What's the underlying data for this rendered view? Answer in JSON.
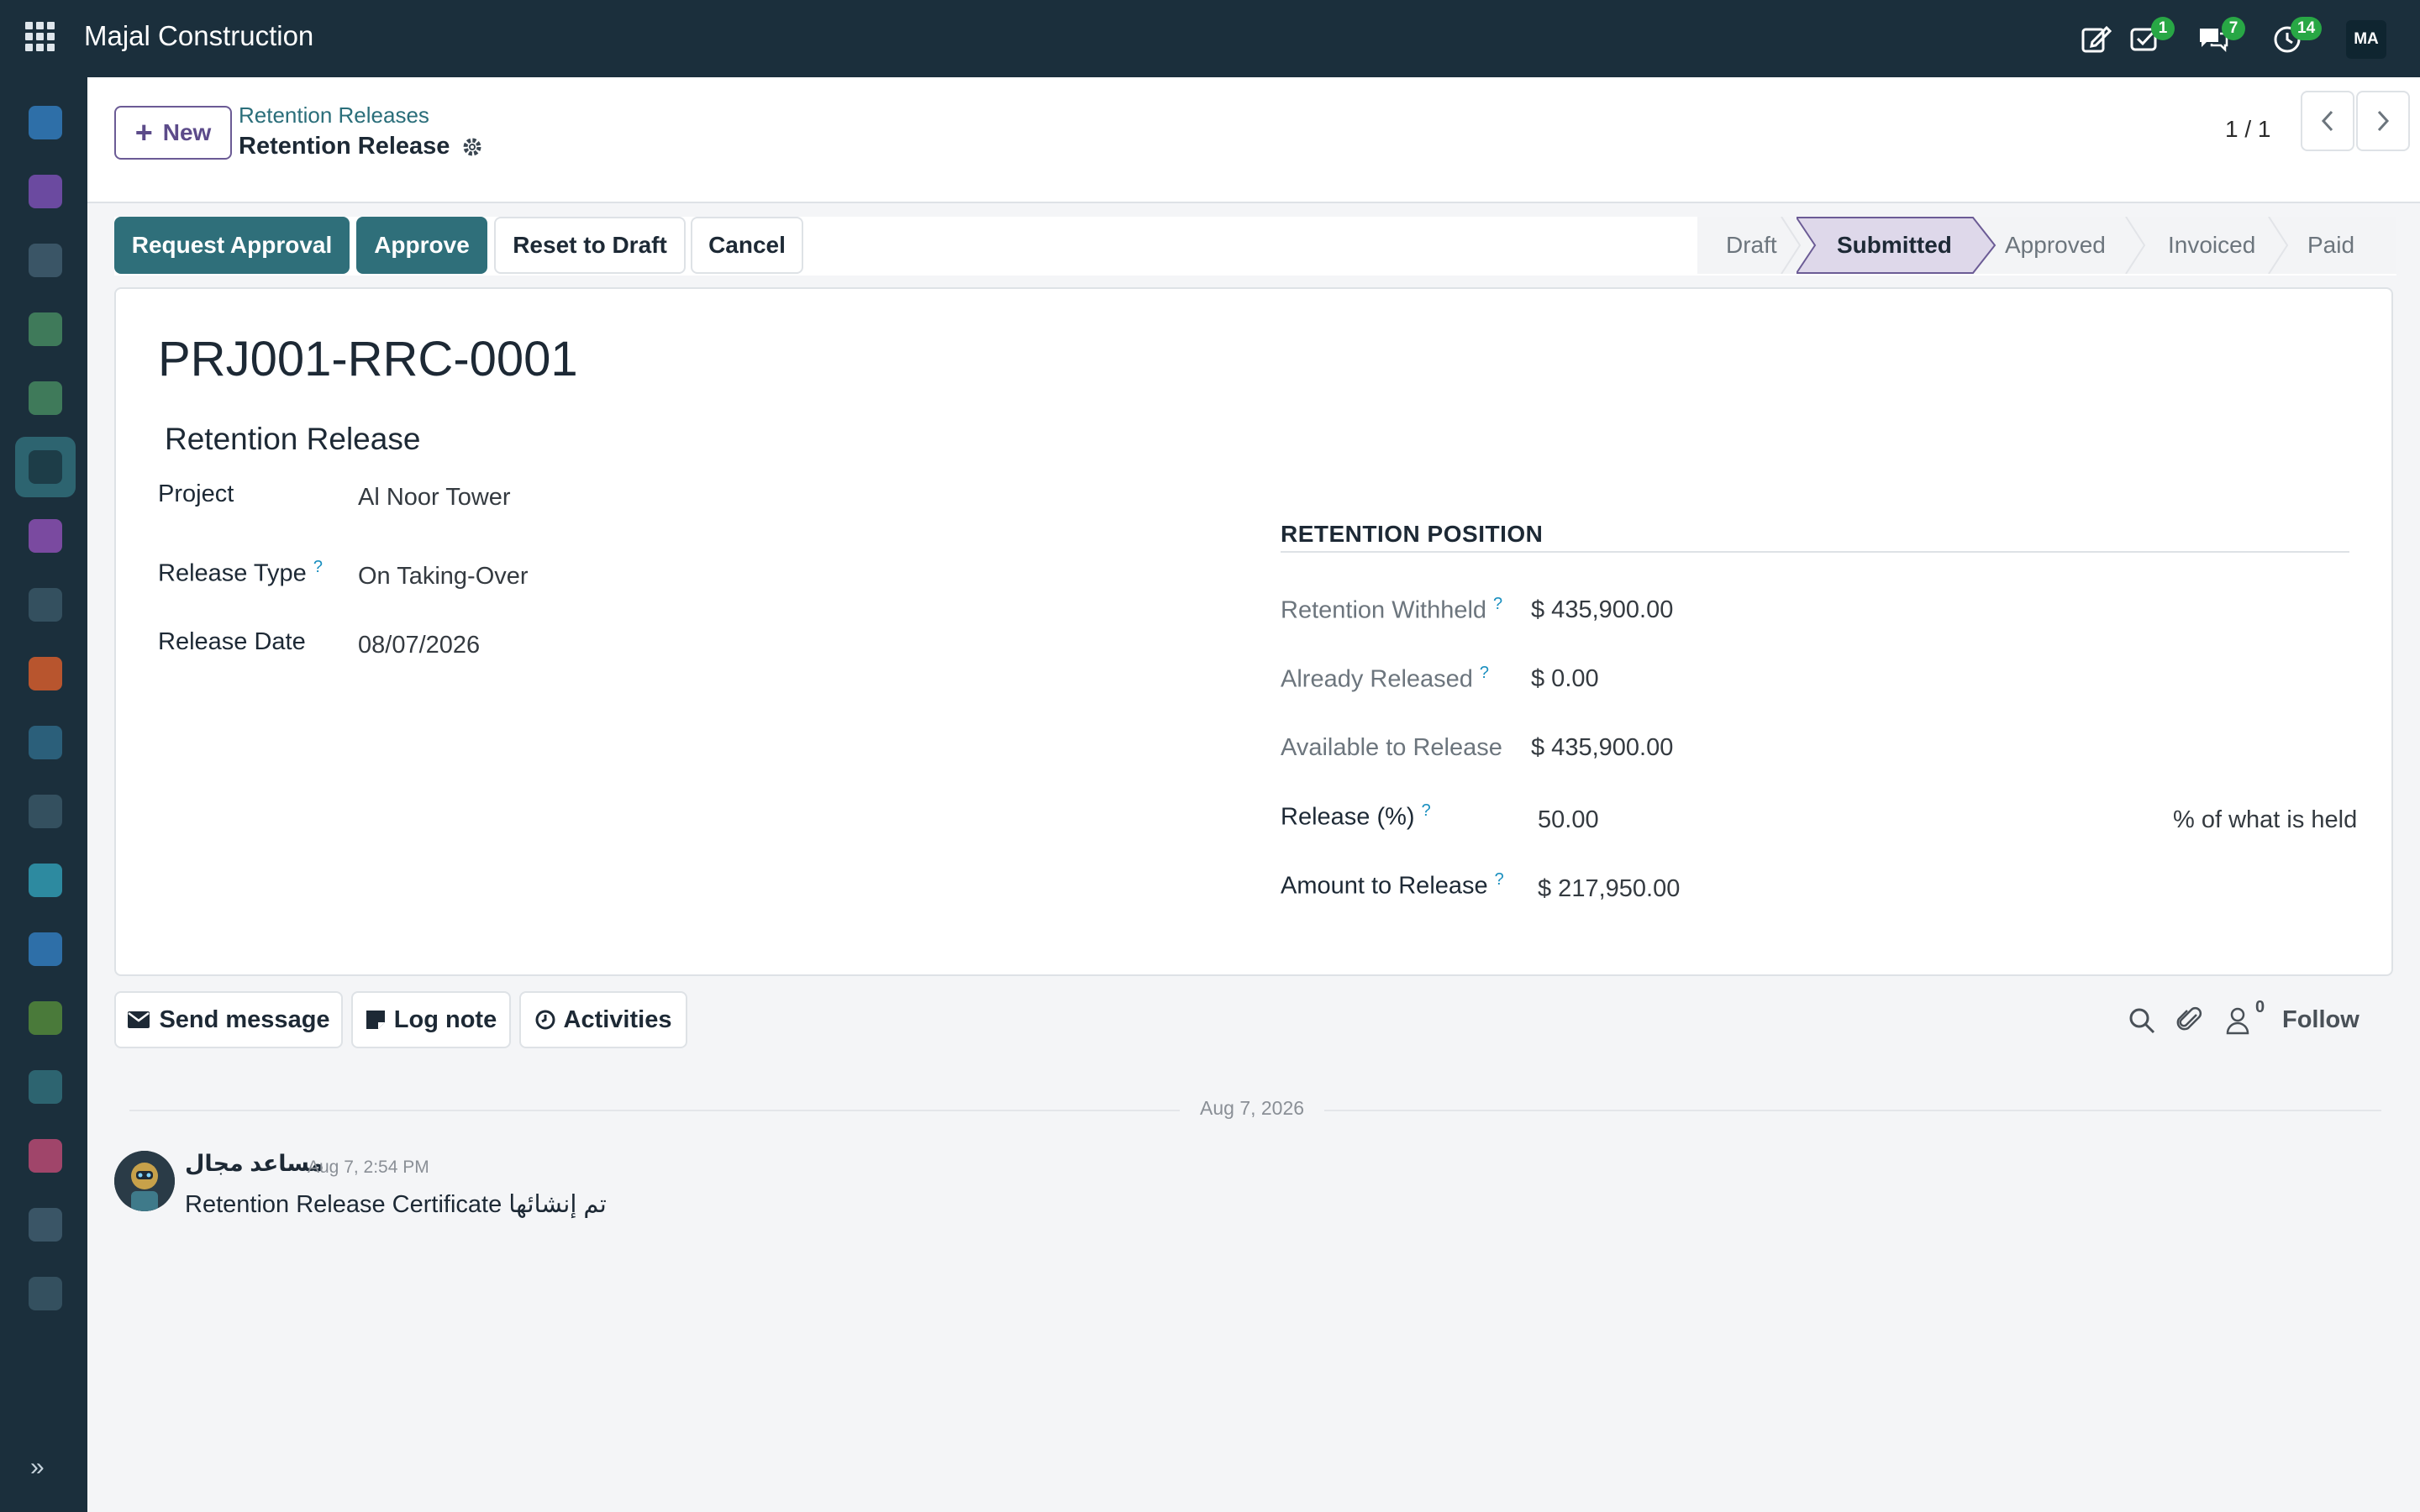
{
  "topbar": {
    "app_name": "Majal Construction",
    "activity_badge": "1",
    "messages_badge": "7",
    "clock_badge": "14",
    "user_initials": "MA"
  },
  "control": {
    "new_label": "New",
    "breadcrumb_parent": "Retention Releases",
    "breadcrumb_current": "Retention Release",
    "pager": "1 / 1"
  },
  "statusbar": {
    "buttons": [
      "Request Approval",
      "Approve",
      "Reset to Draft",
      "Cancel"
    ],
    "stages": [
      "Draft",
      "Submitted",
      "Approved",
      "Invoiced",
      "Paid"
    ],
    "current_stage": "Submitted"
  },
  "form": {
    "record_name": "PRJ001-RRC-0001",
    "section_title": "Retention Release",
    "project_label": "Project",
    "project_value": "Al Noor Tower",
    "release_type_label": "Release Type",
    "release_type_value": "On Taking-Over",
    "release_date_label": "Release Date",
    "release_date_value": "08/07/2026",
    "help_mark": "?",
    "position": {
      "title": "RETENTION POSITION",
      "withheld_label": "Retention Withheld",
      "withheld_value": "$ 435,900.00",
      "released_label": "Already Released",
      "released_value": "$ 0.00",
      "available_label": "Available to Release",
      "available_value": "$ 435,900.00",
      "percent_label": "Release (%)",
      "percent_value": "50.00",
      "percent_hint": "% of what is held",
      "amount_label": "Amount to Release",
      "amount_value": "$ 217,950.00"
    }
  },
  "chatter": {
    "send_message": "Send message",
    "log_note": "Log note",
    "activities": "Activities",
    "followers_count": "0",
    "follow": "Follow",
    "date_separator": "Aug 7, 2026",
    "message": {
      "author": "مساعد مجال",
      "time": "Aug 7, 2:54 PM",
      "body": "Retention Release Certificate تم إنشائها"
    }
  },
  "colors": {
    "navbar": "#1b2f3c",
    "primary_button": "#2f6f7a",
    "new_button": "#5c4b8a",
    "badge": "#28a745",
    "help": "#1a8fbf"
  }
}
